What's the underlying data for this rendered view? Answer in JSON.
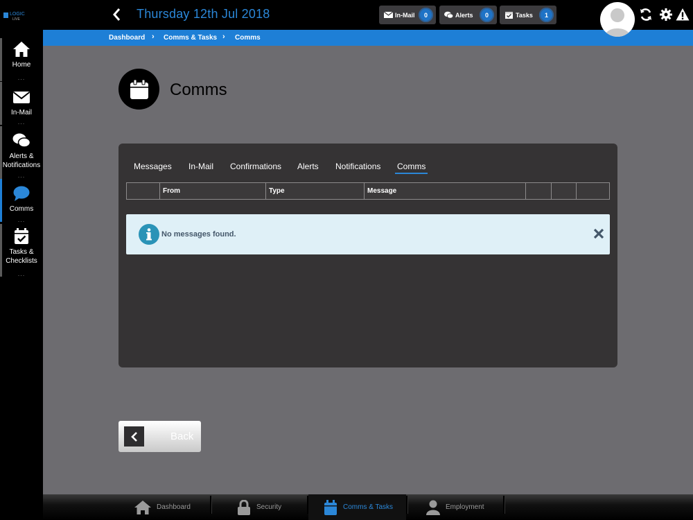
{
  "header": {
    "date_title": "Thursday 12th Jul 2018",
    "pills": [
      {
        "label": "In-Mail",
        "count": "0",
        "icon": "envelope-icon"
      },
      {
        "label": "Alerts",
        "count": "0",
        "icon": "chat-bubbles-icon"
      },
      {
        "label": "Tasks",
        "count": "1",
        "icon": "calendar-check-icon"
      }
    ],
    "icons": [
      "refresh-icon",
      "gear-icon",
      "warning-icon"
    ],
    "accent": "#2b87d8"
  },
  "breadcrumb": [
    "Dashboard",
    "Comms & Tasks",
    "Comms"
  ],
  "sidebar": {
    "items": [
      {
        "label": "Home",
        "icon": "home-icon"
      },
      {
        "label": "In-Mail",
        "icon": "envelope-icon"
      },
      {
        "label": "Alerts &",
        "label2": "Notifications",
        "icon": "chat-bubbles-icon"
      },
      {
        "label": "Comms",
        "icon": "chat-bubble-icon",
        "active": true
      },
      {
        "label": "Tasks &",
        "label2": "Checklists",
        "icon": "calendar-check-icon"
      }
    ],
    "dots": "..."
  },
  "page": {
    "title": "Comms",
    "icon": "calendar-icon"
  },
  "tabs": [
    "Messages",
    "In-Mail",
    "Confirmations",
    "Alerts",
    "Notifications",
    "Comms"
  ],
  "active_tab": "Comms",
  "table": {
    "columns": [
      "",
      "From",
      "Type",
      "Message",
      "",
      "",
      ""
    ]
  },
  "alert": {
    "message": "No messages found."
  },
  "back_button": {
    "label": "Back"
  },
  "bottom_nav": [
    {
      "label": "Dashboard",
      "icon": "home-icon"
    },
    {
      "label": "Security",
      "icon": "lock-icon"
    },
    {
      "label": "Comms & Tasks",
      "icon": "calendar-icon",
      "active": true
    },
    {
      "label": "Employment",
      "icon": "user-icon"
    }
  ],
  "colors": {
    "topbar": "#000000",
    "breadcrumb_bar": "#1e7fd6",
    "page_bg": "#6d6c70",
    "panel_bg": "#353334",
    "alert_bg": "#dff0f7"
  }
}
